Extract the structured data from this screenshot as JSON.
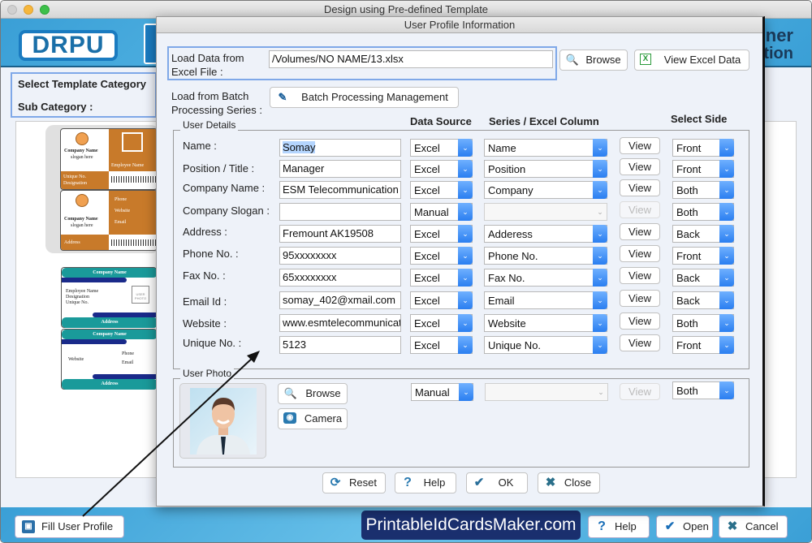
{
  "window": {
    "title": "Design using Pre-defined Template"
  },
  "banner": {
    "logo": "DRPU",
    "right_line1": "ner",
    "right_line2": "tion"
  },
  "left_panel": {
    "template_category_label": "Select Template Category",
    "sub_category_label": "Sub Category :"
  },
  "templates": [
    {
      "company": "Company Name",
      "slogan": "slogan here",
      "photo": "USER PHOTO",
      "employee": "Employee Name",
      "unique": "Unique No.",
      "designation": "Designation",
      "phone": "Phone",
      "website": "Website",
      "email": "Email",
      "address": "Address"
    },
    {
      "company": "Company Name",
      "employee": "Employee Name",
      "designation": "Designation",
      "unique": "Unique No.",
      "photo": "USER PHOTO",
      "address": "Address",
      "website": "Website",
      "phone": "Phone",
      "email": "Email"
    }
  ],
  "dialog": {
    "title": "User Profile Information",
    "excel_label": "Load Data from Excel File :",
    "excel_path": "/Volumes/NO NAME/13.xlsx",
    "browse_label": "Browse",
    "view_excel_label": "View Excel Data",
    "batch_label": "Load from Batch Processing Series :",
    "batch_button": "Batch Processing Management",
    "user_details_legend": "User Details",
    "headers": {
      "data_source": "Data Source",
      "series_column": "Series / Excel Column",
      "select_side": "Select Side"
    },
    "rows": [
      {
        "label": "Name :",
        "value": "Somay",
        "source": "Excel",
        "column": "Name",
        "view": "View",
        "side": "Front",
        "disabled": false
      },
      {
        "label": "Position / Title :",
        "value": "Manager",
        "source": "Excel",
        "column": "Position",
        "view": "View",
        "side": "Front",
        "disabled": false
      },
      {
        "label": "Company Name :",
        "value": "ESM Telecommunication I",
        "source": "Excel",
        "column": "Company",
        "view": "View",
        "side": "Both",
        "disabled": false
      },
      {
        "label": "Company Slogan :",
        "value": "",
        "source": "Manual",
        "column": "",
        "view": "View",
        "side": "Both",
        "disabled": true
      },
      {
        "label": "Address :",
        "value": "Fremount AK19508",
        "source": "Excel",
        "column": "Adderess",
        "view": "View",
        "side": "Back",
        "disabled": false
      },
      {
        "label": "Phone No. :",
        "value": "95xxxxxxxx",
        "source": "Excel",
        "column": "Phone No.",
        "view": "View",
        "side": "Front",
        "disabled": false
      },
      {
        "label": "Fax No. :",
        "value": "65xxxxxxxx",
        "source": "Excel",
        "column": "Fax No.",
        "view": "View",
        "side": "Back",
        "disabled": false
      },
      {
        "label": "Email Id :",
        "value": "somay_402@xmail.com",
        "source": "Excel",
        "column": "Email",
        "view": "View",
        "side": "Back",
        "disabled": false
      },
      {
        "label": "Website :",
        "value": "www.esmtelecommunicat",
        "source": "Excel",
        "column": "Website",
        "view": "View",
        "side": "Both",
        "disabled": false
      },
      {
        "label": "Unique No. :",
        "value": "5123",
        "source": "Excel",
        "column": "Unique No.",
        "view": "View",
        "side": "Front",
        "disabled": false
      }
    ],
    "photo": {
      "legend": "User Photo",
      "browse": "Browse",
      "camera": "Camera",
      "source": "Manual",
      "column": "",
      "view": "View",
      "side": "Both"
    },
    "buttons": {
      "reset": "Reset",
      "help": "Help",
      "ok": "OK",
      "close": "Close"
    }
  },
  "bottom": {
    "fill_profile": "Fill User Profile",
    "brand": "PrintableIdCardsMaker.com",
    "help": "Help",
    "open": "Open",
    "cancel": "Cancel"
  }
}
